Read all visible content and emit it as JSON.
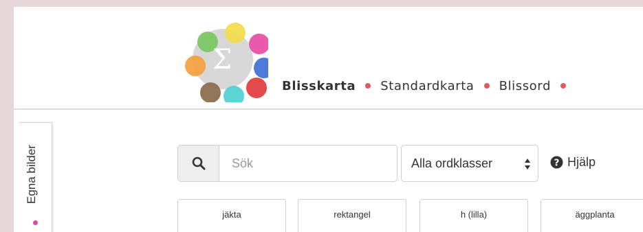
{
  "header": {
    "logo": {
      "center_glyph": "Σ",
      "dot_colors": [
        "#f2dc4b",
        "#e94ba6",
        "#3f6fd8",
        "#e23b3b",
        "#4fcfd1",
        "#8a6a4b",
        "#f3a03d",
        "#78c862"
      ]
    },
    "nav": [
      {
        "label": "Blisskarta",
        "active": true
      },
      {
        "label": "Standardkarta",
        "active": false
      },
      {
        "label": "Blissord",
        "active": false
      }
    ],
    "separator_color": "#e0595c"
  },
  "side_tab": {
    "label": "Egna bilder",
    "marker_color": "#d04fa8"
  },
  "search": {
    "icon": "search-icon",
    "placeholder": "Sök",
    "value": ""
  },
  "word_class_select": {
    "selected": "Alla ordklasser"
  },
  "help": {
    "icon": "question-circle-icon",
    "label": "Hjälp"
  },
  "cards": [
    {
      "label": "jäkta"
    },
    {
      "label": "rektangel"
    },
    {
      "label": "h (lilla)"
    },
    {
      "label": "äggplanta"
    }
  ]
}
